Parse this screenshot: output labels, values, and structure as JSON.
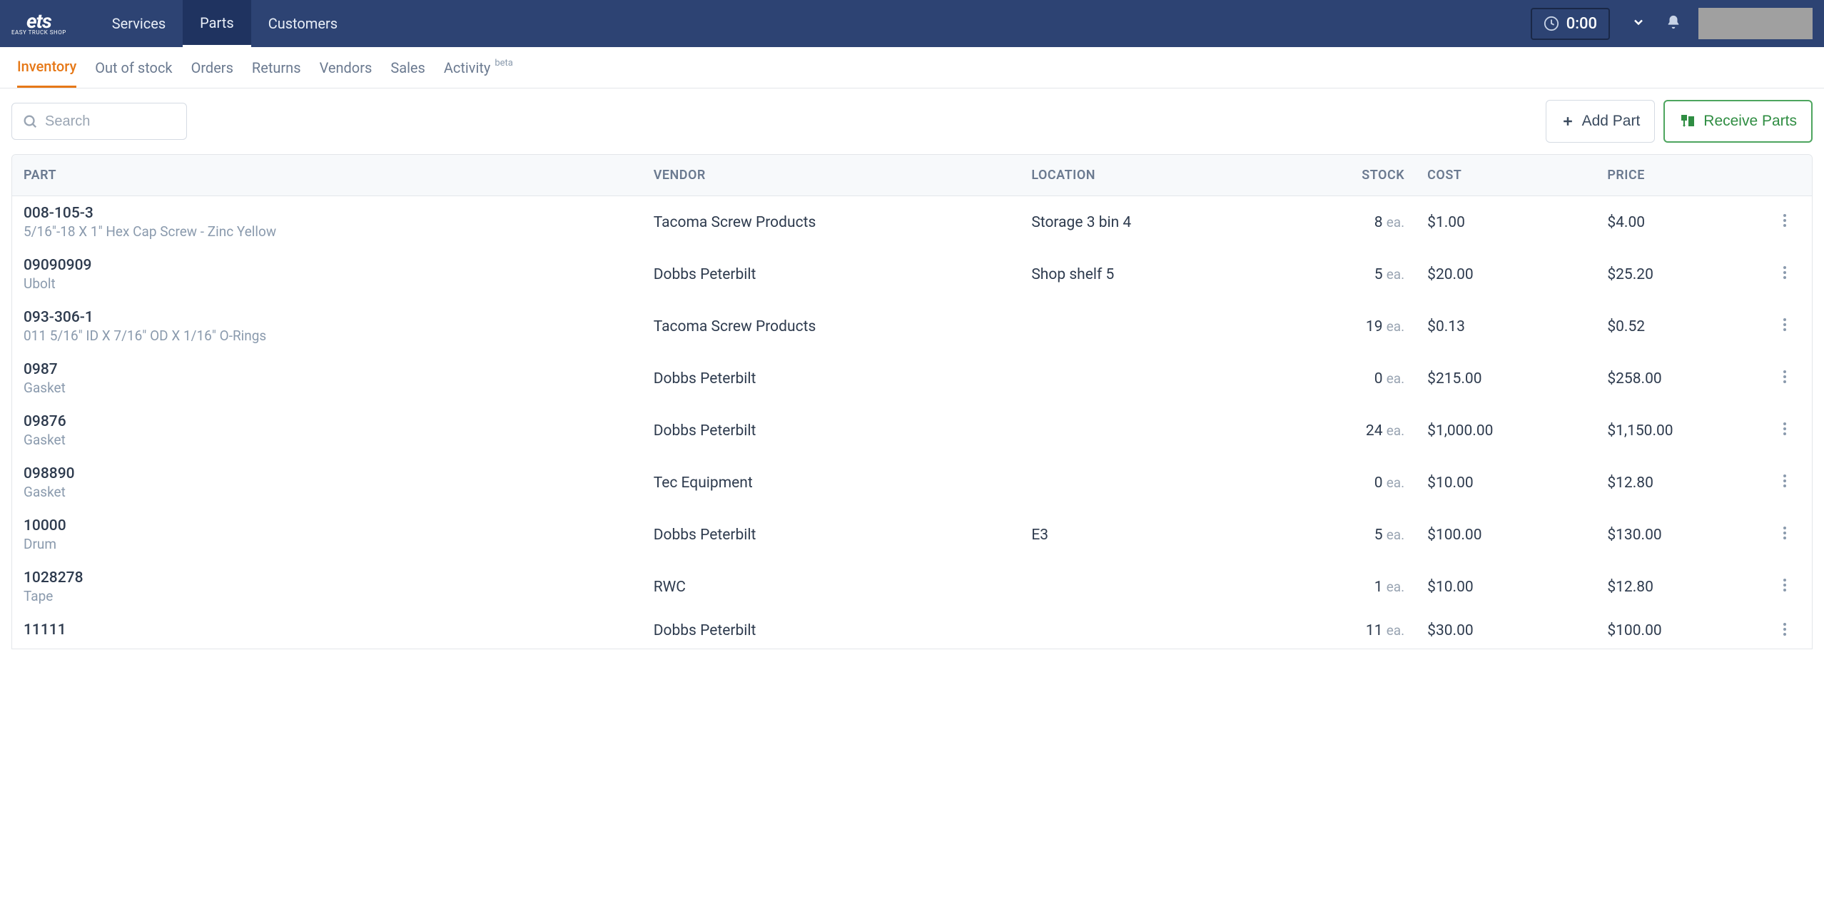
{
  "logo": {
    "main": "ets",
    "sub": "EASY TRUCK SHOP"
  },
  "topnav": {
    "items": [
      "Services",
      "Parts",
      "Customers"
    ],
    "active": 1
  },
  "timer": "0:00",
  "subnav": {
    "items": [
      "Inventory",
      "Out of stock",
      "Orders",
      "Returns",
      "Vendors",
      "Sales",
      "Activity"
    ],
    "active": 0,
    "beta_label": "beta"
  },
  "toolbar": {
    "search_placeholder": "Search",
    "add_part_label": "Add Part",
    "receive_parts_label": "Receive Parts"
  },
  "table": {
    "headers": {
      "part": "PART",
      "vendor": "VENDOR",
      "location": "LOCATION",
      "stock": "STOCK",
      "cost": "COST",
      "price": "PRICE"
    },
    "stock_unit": "ea.",
    "rows": [
      {
        "part_num": "008-105-3",
        "part_desc": "5/16\"-18 X 1\" Hex Cap Screw - Zinc Yellow",
        "vendor": "Tacoma Screw Products",
        "location": "Storage 3 bin 4",
        "stock": "8",
        "cost": "$1.00",
        "price": "$4.00"
      },
      {
        "part_num": "09090909",
        "part_desc": "Ubolt",
        "vendor": "Dobbs Peterbilt",
        "location": "Shop shelf 5",
        "stock": "5",
        "cost": "$20.00",
        "price": "$25.20"
      },
      {
        "part_num": "093-306-1",
        "part_desc": "011 5/16\" ID X 7/16\" OD X 1/16\" O-Rings",
        "vendor": "Tacoma Screw Products",
        "location": "",
        "stock": "19",
        "cost": "$0.13",
        "price": "$0.52"
      },
      {
        "part_num": "0987",
        "part_desc": "Gasket",
        "vendor": "Dobbs Peterbilt",
        "location": "",
        "stock": "0",
        "cost": "$215.00",
        "price": "$258.00"
      },
      {
        "part_num": "09876",
        "part_desc": "Gasket",
        "vendor": "Dobbs Peterbilt",
        "location": "",
        "stock": "24",
        "cost": "$1,000.00",
        "price": "$1,150.00"
      },
      {
        "part_num": "098890",
        "part_desc": "Gasket",
        "vendor": "Tec Equipment",
        "location": "",
        "stock": "0",
        "cost": "$10.00",
        "price": "$12.80"
      },
      {
        "part_num": "10000",
        "part_desc": "Drum",
        "vendor": "Dobbs Peterbilt",
        "location": "E3",
        "stock": "5",
        "cost": "$100.00",
        "price": "$130.00"
      },
      {
        "part_num": "1028278",
        "part_desc": "Tape",
        "vendor": "RWC",
        "location": "",
        "stock": "1",
        "cost": "$10.00",
        "price": "$12.80"
      },
      {
        "part_num": "11111",
        "part_desc": "",
        "vendor": "Dobbs Peterbilt",
        "location": "",
        "stock": "11",
        "cost": "$30.00",
        "price": "$100.00"
      }
    ]
  }
}
